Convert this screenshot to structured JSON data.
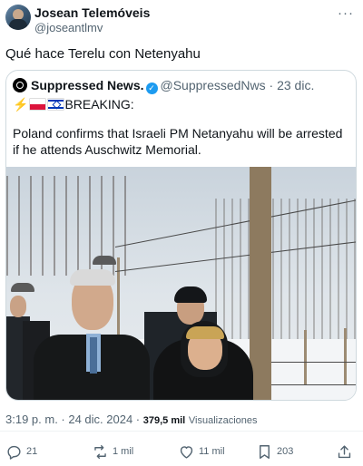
{
  "tweet": {
    "author_name": "Josean Telemóveis",
    "author_handle": "@joseantlmv",
    "text": "Qué hace Terelu con Netenyahu",
    "more_icon": "more-icon"
  },
  "quoted": {
    "author_name": "Suppressed News.",
    "author_handle": "@SuppressedNws",
    "date": "· 23 dic.",
    "prefix": "BREAKING:",
    "body": "Poland confirms that Israeli PM Netanyahu will be arrested if he attends Auschwitz Memorial."
  },
  "meta": {
    "time_date": "3:19 p. m. · 24 dic. 2024 ·",
    "views_count": "379,5 mil",
    "views_label": "Visualizaciones"
  },
  "actions": {
    "replies": "21",
    "reposts": "1 mil",
    "likes": "11 mil",
    "bookmarks": "203"
  },
  "colors": {
    "text": "#0f1419",
    "secondary": "#536471",
    "border": "#cfd9de",
    "verified": "#1d9bf0"
  }
}
